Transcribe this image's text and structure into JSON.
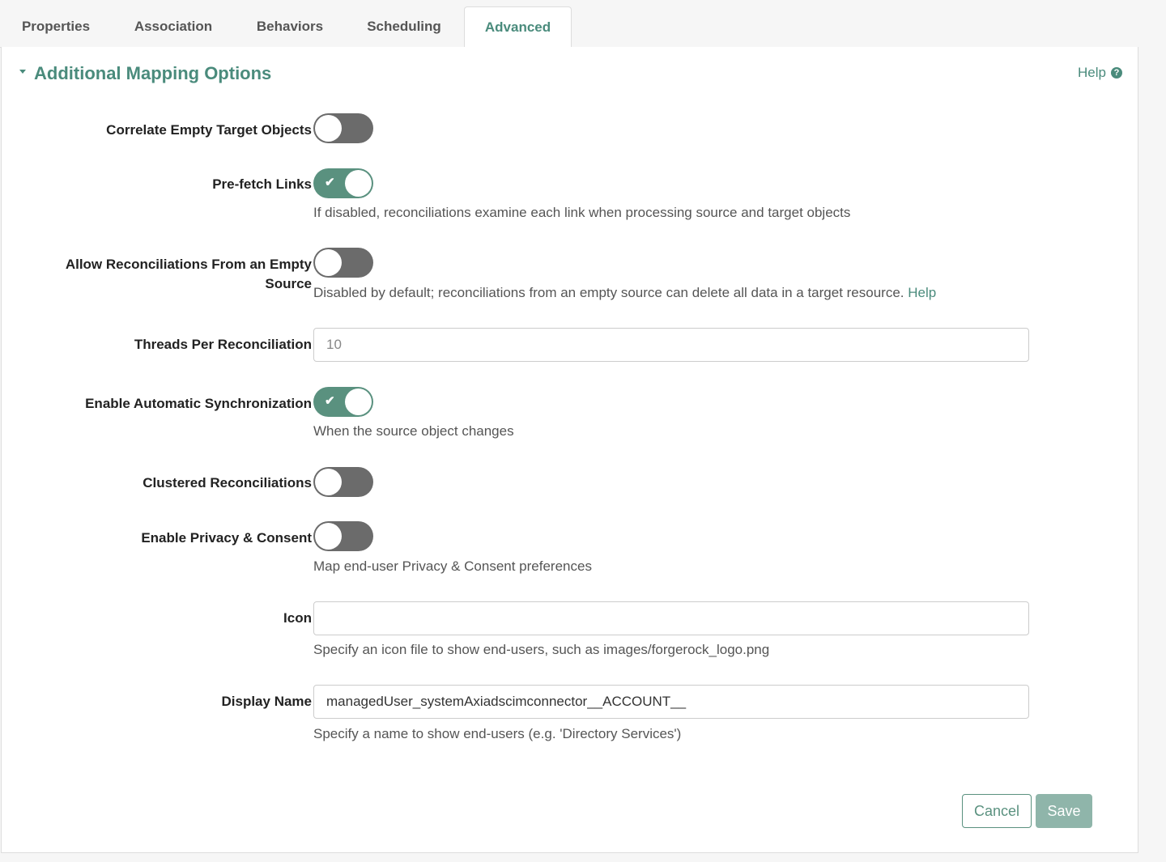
{
  "tabs": [
    {
      "label": "Properties"
    },
    {
      "label": "Association"
    },
    {
      "label": "Behaviors"
    },
    {
      "label": "Scheduling"
    },
    {
      "label": "Advanced"
    }
  ],
  "active_tab": "Advanced",
  "section": {
    "title": "Additional Mapping Options",
    "help_label": "Help",
    "help_icon": "question-circle-icon"
  },
  "fields": {
    "correlate_empty": {
      "label": "Correlate Empty Target Objects",
      "enabled": false
    },
    "prefetch_links": {
      "label": "Pre-fetch Links",
      "enabled": true,
      "hint": "If disabled, reconciliations examine each link when processing source and target objects"
    },
    "allow_empty_source": {
      "label_line1": "Allow Reconciliations From an Empty",
      "label_line2": "Source",
      "enabled": false,
      "hint": "Disabled by default; reconciliations from an empty source can delete all data in a target resource.",
      "hint_link": "Help"
    },
    "threads": {
      "label": "Threads Per Reconciliation",
      "placeholder": "10",
      "value": ""
    },
    "auto_sync": {
      "label": "Enable Automatic Synchronization",
      "enabled": true,
      "hint": "When the source object changes"
    },
    "clustered": {
      "label": "Clustered Reconciliations",
      "enabled": false
    },
    "privacy": {
      "label": "Enable Privacy & Consent",
      "enabled": false,
      "hint": "Map end-user Privacy & Consent preferences"
    },
    "icon": {
      "label": "Icon",
      "value": "",
      "hint": "Specify an icon file to show end-users, such as images/forgerock_logo.png"
    },
    "display_name": {
      "label": "Display Name",
      "value": "managedUser_systemAxiadscimconnector__ACCOUNT__",
      "hint": "Specify a name to show end-users (e.g. 'Directory Services')"
    }
  },
  "buttons": {
    "cancel": "Cancel",
    "save": "Save"
  },
  "colors": {
    "accent": "#4a8b7c",
    "toggle_on": "#5a917f",
    "toggle_off": "#6b6b6b",
    "save_disabled": "#8fb5aa"
  }
}
